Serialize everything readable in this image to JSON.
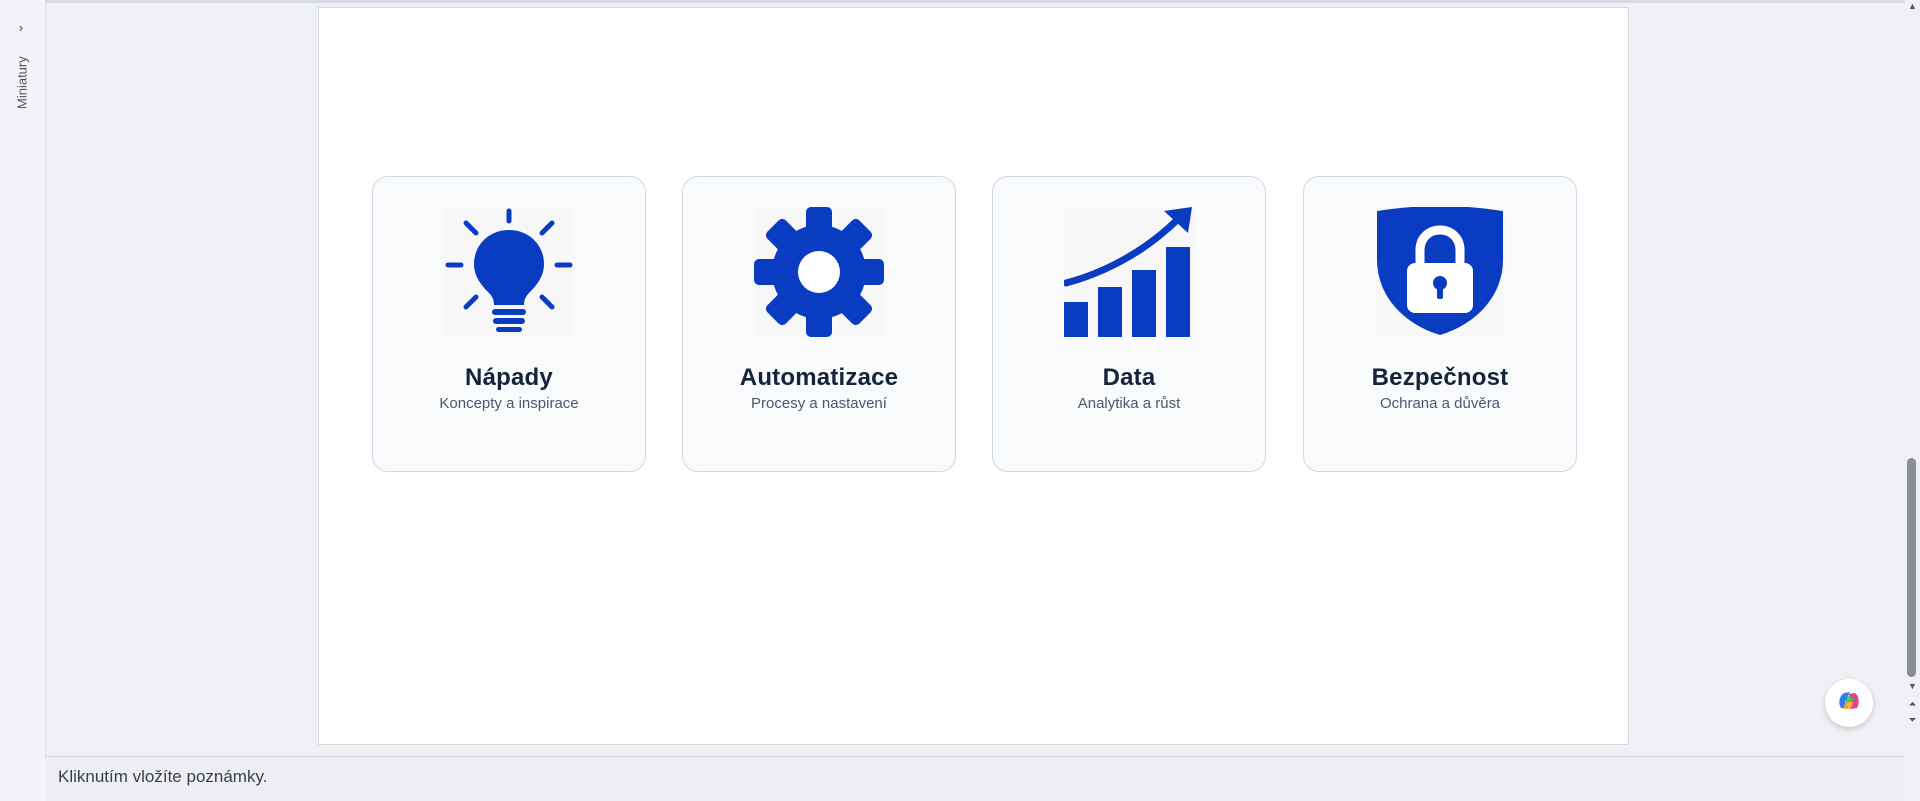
{
  "thumbnails": {
    "label": "Miniatury",
    "toggle_icon": "chevron-right-icon"
  },
  "slide": {
    "icon_color": "#0a3cc2",
    "cards": [
      {
        "title": "Nápady",
        "subtitle": "Koncepty a inspirace",
        "icon": "lightbulb-icon"
      },
      {
        "title": "Automatizace",
        "subtitle": "Procesy a nastavení",
        "icon": "gear-icon"
      },
      {
        "title": "Data",
        "subtitle": "Analytika a růst",
        "icon": "growth-chart-icon"
      },
      {
        "title": "Bezpečnost",
        "subtitle": "Ochrana a důvěra",
        "icon": "shield-lock-icon"
      }
    ]
  },
  "notes": {
    "placeholder": "Kliknutím vložíte poznámky."
  },
  "scrollbar": {
    "up_icon": "triangle-up-icon",
    "down_icon": "triangle-down-icon",
    "prev_page_icon": "double-chevron-up-icon",
    "next_page_icon": "double-chevron-down-icon"
  },
  "copilot": {
    "icon": "copilot-icon"
  }
}
